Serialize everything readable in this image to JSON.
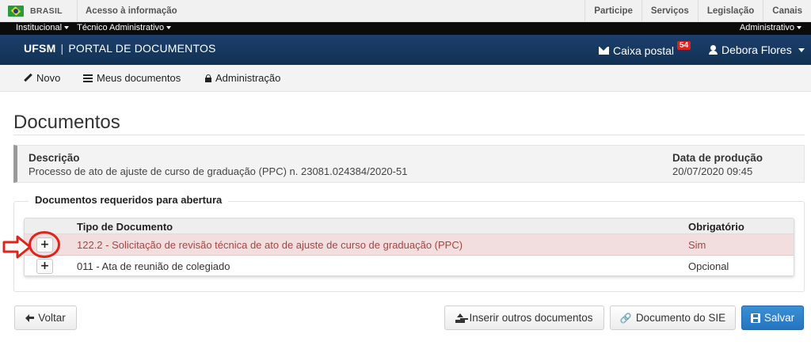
{
  "govbar": {
    "country": "BRASIL",
    "access": "Acesso à informação",
    "links": [
      "Participe",
      "Serviços",
      "Legislação",
      "Canais"
    ]
  },
  "topbar": {
    "left_menus": [
      "Institucional",
      "Técnico Administrativo"
    ],
    "right_menu": "Administrativo"
  },
  "header": {
    "brand_bold": "UFSM",
    "brand_separator": "|",
    "brand_text": "PORTAL DE DOCUMENTOS",
    "mail_label": "Caixa postal",
    "mail_count": "54",
    "user_name": "Debora Flores"
  },
  "menu": {
    "new": "Novo",
    "my_docs": "Meus documentos",
    "admin": "Administração"
  },
  "page": {
    "title": "Documentos"
  },
  "description": {
    "label": "Descrição",
    "value": "Processo de ato de ajuste de curso de graduação (PPC) n. 23081.024384/2020-51",
    "date_label": "Data de produção",
    "date_value": "20/07/2020 09:45"
  },
  "required_docs": {
    "legend": "Documentos requeridos para abertura",
    "columns": [
      "Tipo de Documento",
      "Obrigatório"
    ],
    "rows": [
      {
        "type": "122.2 - Solicitação de revisão técnica de ato de ajuste de curso de graduação (PPC)",
        "required": "Sim",
        "add": "+"
      },
      {
        "type": "011 - Ata de reunião de colegiado",
        "required": "Opcional",
        "add": "+"
      }
    ]
  },
  "actions": {
    "back": "Voltar",
    "insert_other": "Inserir outros documentos",
    "sie_doc": "Documento do SIE",
    "save": "Salvar"
  },
  "colors": {
    "header_blue": "#1c3f6c",
    "required_row": "#f2dede",
    "required_text": "#a94442",
    "badge_red": "#d9261c",
    "annotation_red": "#e2231a",
    "primary_button": "#2a78c4"
  }
}
